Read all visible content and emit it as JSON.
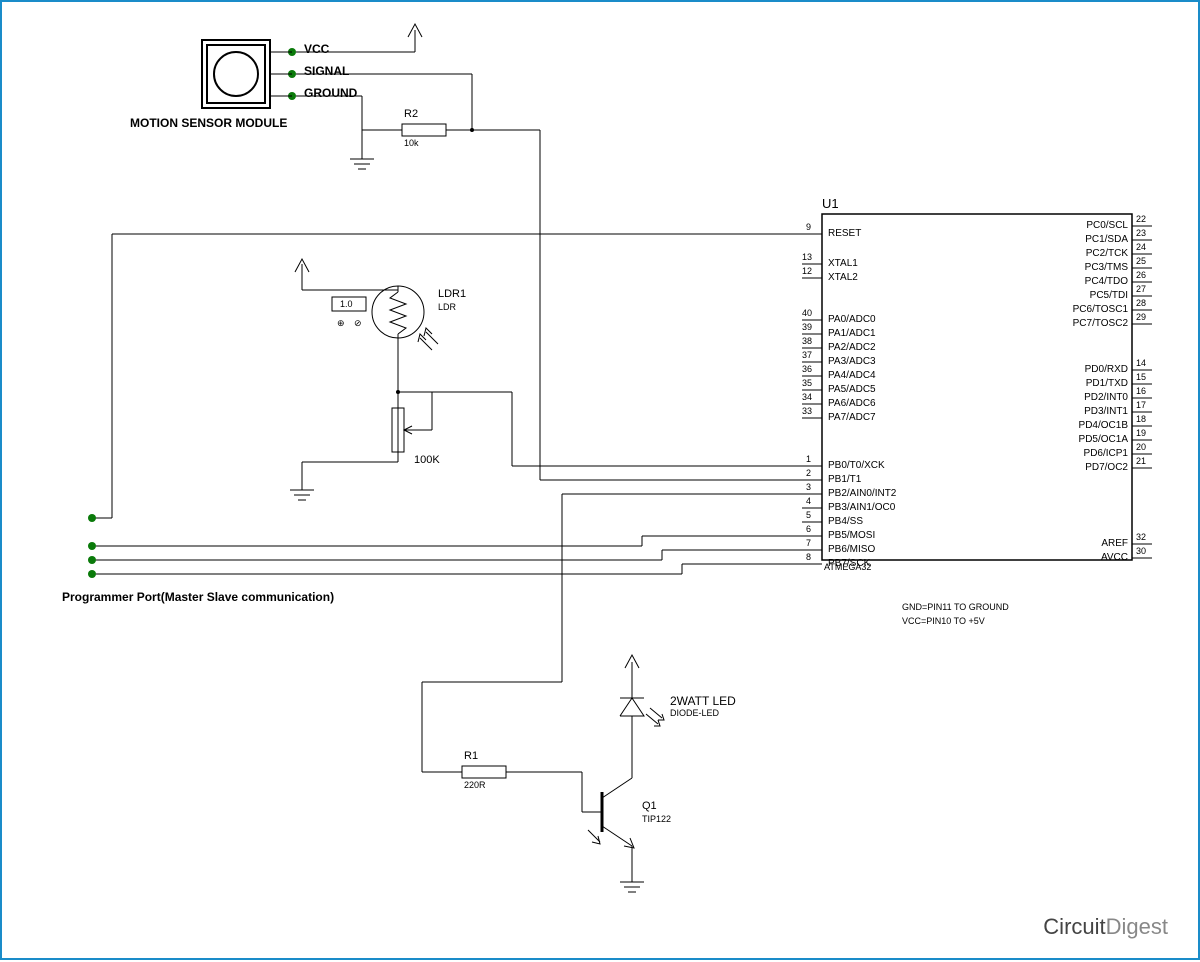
{
  "motionSensor": {
    "title": "MOTION SENSOR MODULE",
    "pin1": "VCC",
    "pin2": "SIGNAL",
    "pin3": "GROUND"
  },
  "r2": {
    "name": "R2",
    "value": "10k"
  },
  "ldr": {
    "name": "LDR1",
    "sub": "LDR",
    "meter": "1.0"
  },
  "pot": {
    "value": "100K"
  },
  "programmer": {
    "title": "Programmer Port(Master Slave communication)"
  },
  "u1": {
    "name": "U1",
    "part": "ATMEGA32",
    "notes1": "GND=PIN11  TO  GROUND",
    "notes2": "VCC=PIN10  TO  +5V",
    "left": [
      {
        "num": "9",
        "name": "RESET"
      },
      {
        "num": "13",
        "name": "XTAL1"
      },
      {
        "num": "12",
        "name": "XTAL2"
      },
      {
        "num": "40",
        "name": "PA0/ADC0"
      },
      {
        "num": "39",
        "name": "PA1/ADC1"
      },
      {
        "num": "38",
        "name": "PA2/ADC2"
      },
      {
        "num": "37",
        "name": "PA3/ADC3"
      },
      {
        "num": "36",
        "name": "PA4/ADC4"
      },
      {
        "num": "35",
        "name": "PA5/ADC5"
      },
      {
        "num": "34",
        "name": "PA6/ADC6"
      },
      {
        "num": "33",
        "name": "PA7/ADC7"
      },
      {
        "num": "1",
        "name": "PB0/T0/XCK"
      },
      {
        "num": "2",
        "name": "PB1/T1"
      },
      {
        "num": "3",
        "name": "PB2/AIN0/INT2"
      },
      {
        "num": "4",
        "name": "PB3/AIN1/OC0"
      },
      {
        "num": "5",
        "name": "PB4/SS"
      },
      {
        "num": "6",
        "name": "PB5/MOSI"
      },
      {
        "num": "7",
        "name": "PB6/MISO"
      },
      {
        "num": "8",
        "name": "PB7/SCK"
      }
    ],
    "right": [
      {
        "num": "22",
        "name": "PC0/SCL"
      },
      {
        "num": "23",
        "name": "PC1/SDA"
      },
      {
        "num": "24",
        "name": "PC2/TCK"
      },
      {
        "num": "25",
        "name": "PC3/TMS"
      },
      {
        "num": "26",
        "name": "PC4/TDO"
      },
      {
        "num": "27",
        "name": "PC5/TDI"
      },
      {
        "num": "28",
        "name": "PC6/TOSC1"
      },
      {
        "num": "29",
        "name": "PC7/TOSC2"
      },
      {
        "num": "14",
        "name": "PD0/RXD"
      },
      {
        "num": "15",
        "name": "PD1/TXD"
      },
      {
        "num": "16",
        "name": "PD2/INT0"
      },
      {
        "num": "17",
        "name": "PD3/INT1"
      },
      {
        "num": "18",
        "name": "PD4/OC1B"
      },
      {
        "num": "19",
        "name": "PD5/OC1A"
      },
      {
        "num": "20",
        "name": "PD6/ICP1"
      },
      {
        "num": "21",
        "name": "PD7/OC2"
      },
      {
        "num": "32",
        "name": "AREF"
      },
      {
        "num": "30",
        "name": "AVCC"
      }
    ]
  },
  "led": {
    "name": "2WATT LED",
    "sub": "DIODE-LED"
  },
  "r1": {
    "name": "R1",
    "value": "220R"
  },
  "q1": {
    "name": "Q1",
    "sub": "TIP122"
  },
  "logo": {
    "a": "Circuit",
    "b": "Digest"
  }
}
